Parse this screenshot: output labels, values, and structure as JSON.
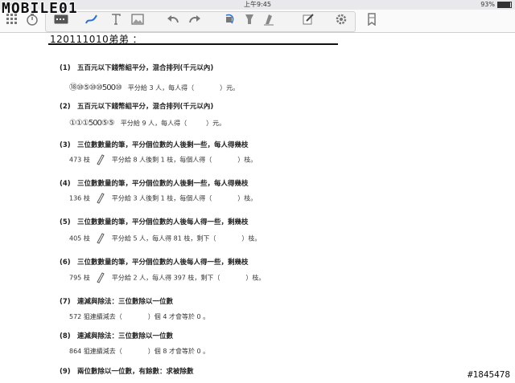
{
  "statusbar": {
    "carrier": "iPad",
    "time": "上午9:45",
    "battery": "93%"
  },
  "watermark": {
    "logo": "MOBILE01",
    "id": "#1845478"
  },
  "toolbar": {
    "icons": [
      "grid-icon",
      "timer-icon",
      "keyboard-icon",
      "pen-icon",
      "text-icon",
      "image-icon",
      "undo-icon",
      "redo-icon",
      "eraser-icon",
      "highlighter-icon",
      "brush-icon",
      "edit-page-icon",
      "settings-icon",
      "bookmark-icon"
    ]
  },
  "document": {
    "title": "120111010弟弟 ：",
    "questions": [
      {
        "num": "(1)",
        "heading": "五百元以下錢幣組平分，混合排列(千元以內)",
        "coins": "⑱⑩⑤⑩⑩500⑩",
        "text": "平分給 3 人，每人得（　　　　）元。"
      },
      {
        "num": "(2)",
        "heading": "五百元以下錢幣組平分，混合排列(千元以內)",
        "coins": "①①①500⑤⑤",
        "text": "平分給 9 人，每人得（　　　）元。"
      },
      {
        "num": "(3)",
        "heading": "三位數數量的筆，平分個位數的人後剩一些，每人得幾枝",
        "count": "473 枝",
        "text": "平分給 8 人後剩 1 枝，每個人得（　　　　）枝。"
      },
      {
        "num": "(4)",
        "heading": "三位數數量的筆，平分個位數的人後剩一些，每人得幾枝",
        "count": "136 枝",
        "text": "平分給 3 人後剩 1 枝，每個人得（　　　　）枝。"
      },
      {
        "num": "(5)",
        "heading": "三位數數量的筆，平分個位數的人後每人得一些，剩幾枝",
        "count": "405 枝",
        "text": "平分給 5 人，每人得 81 枝，剩下（　　　　）枝。"
      },
      {
        "num": "(6)",
        "heading": "三位數數量的筆，平分個位數的人後每人得一些，剩幾枝",
        "count": "795 枝",
        "text": "平分給 2 人，每人得 397 枝，剩下（　　　　）枝。"
      },
      {
        "num": "(7)",
        "heading": "連減與除法：三位數除以一位數",
        "text": "572 狙連續減去（　　　　）個 4 才會等於 0 。"
      },
      {
        "num": "(8)",
        "heading": "連減與除法：三位數除以一位數",
        "text": "864 狙連續減去（　　　　）個 8 才會等於 0 。"
      },
      {
        "num": "(9)",
        "heading": "兩位數除以一位數，有餘數：求被除數"
      }
    ]
  }
}
